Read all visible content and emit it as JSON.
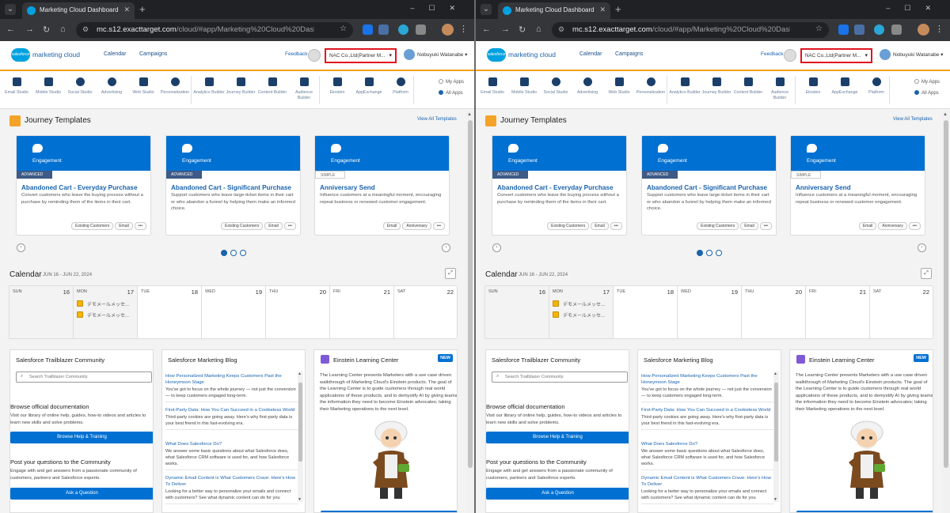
{
  "browser": {
    "tab_title": "Marketing Cloud Dashboard - M",
    "url_host": "mc.s12.exacttarget.com",
    "url_path": "/cloud/#app/Marketing%20Cloud%20Dashboa..."
  },
  "header": {
    "logo_badge": "salesforce",
    "logo_text": "marketing cloud",
    "nav": [
      "Calendar",
      "Campaigns"
    ],
    "feedback": "Feedback",
    "business_unit": "NAC Co.,Ltd(Partner M...",
    "user_name": "Nobuyuki Watanabe"
  },
  "apps": {
    "items": [
      {
        "label": "Email Studio"
      },
      {
        "label": "Mobile Studio"
      },
      {
        "label": "Social Studio"
      },
      {
        "label": "Advertising"
      },
      {
        "label": "Web Studio"
      },
      {
        "label": "Personalization"
      },
      {
        "label": "Analytics Builder"
      },
      {
        "label": "Journey Builder"
      },
      {
        "label": "Content Builder"
      },
      {
        "label": "Audience Builder"
      },
      {
        "label": "Einstein"
      },
      {
        "label": "AppExchange"
      },
      {
        "label": "Platform"
      }
    ],
    "my_apps": "My Apps",
    "all_apps": "All Apps"
  },
  "journey": {
    "title": "Journey Templates",
    "view_all": "View All Templates",
    "cards": [
      {
        "category": "Engagement",
        "level": "ADVANCED",
        "name": "Abandoned Cart - Everyday Purchase",
        "desc": "Convert customers who leave the buying process without a purchase by reminding them of the items in their cart.",
        "chips": [
          "Existing Customers",
          "Email",
          "•••"
        ]
      },
      {
        "category": "Engagement",
        "level": "ADVANCED",
        "name": "Abandoned Cart - Significant Purchase",
        "desc": "Support customers who leave large-ticket items in their cart or who abandon a funnel by helping them make an informed choice.",
        "chips": [
          "Existing Customers",
          "Email",
          "•••"
        ]
      },
      {
        "category": "Engagement",
        "level": "SIMPLE",
        "name": "Anniversary Send",
        "desc": "Influence customers at a meaningful moment, encouraging repeat business or renewed customer engagement.",
        "chips": [
          "Email",
          "Anniversary",
          "•••"
        ]
      }
    ]
  },
  "calendar": {
    "title": "Calendar",
    "range": "JUN 16 - JUN 22, 2024",
    "days": [
      {
        "name": "SUN",
        "num": "16"
      },
      {
        "name": "MON",
        "num": "17"
      },
      {
        "name": "TUE",
        "num": "18"
      },
      {
        "name": "WED",
        "num": "19"
      },
      {
        "name": "THU",
        "num": "20"
      },
      {
        "name": "FRI",
        "num": "21"
      },
      {
        "name": "SAT",
        "num": "22"
      }
    ],
    "events": [
      "デモメールメッセ...",
      "デモメールメッセ..."
    ]
  },
  "trailblazer": {
    "title": "Salesforce Trailblazer Community",
    "search_placeholder": "Search Trailblazer Community",
    "doc_heading": "Browse official documentation",
    "doc_text": "Visit our library of online help, guides, how-to videos and articles to learn new skills and solve problems.",
    "doc_button": "Browse Help & Training",
    "community_heading": "Post your questions to the Community",
    "community_text": "Engage with and get answers from a passionate community of customers, partners and Salesforce experts.",
    "community_button": "Ask a Question"
  },
  "blog": {
    "title": "Salesforce Marketing Blog",
    "items": [
      {
        "title": "How Personalized Marketing Keeps Customers Past the Honeymoon Stage",
        "desc": "You've got to focus on the whole journey — not just the conversion — to keep customers engaged long-term."
      },
      {
        "title": "First-Party Data: How You Can Succeed in a Cookieless World",
        "desc": "Third-party cookies are going away. Here's why first-party data is your best friend in this fast-evolving era."
      },
      {
        "title": "What Does Salesforce Do?",
        "desc": "We answer some basic questions about what Salesforce does, what Salesforce CRM software is used for, and how Salesforce works."
      },
      {
        "title": "Dynamic Email Content is What Customers Crave: Here's How To Deliver",
        "desc": "Looking for a better way to personalize your emails and connect with customers? See what dynamic content can do for you"
      }
    ]
  },
  "einstein": {
    "title": "Einstein Learning Center",
    "badge": "NEW",
    "text": "The Learning Center presents Marketers with a use case driven walkthrough of Marketing Cloud's Einstein products. The goal of the Learning Center is to guide customers through real world applications of these products, and to demystify AI by giving teams the information they need to become Einstein advocates; taking their Marketing operations to the next level."
  },
  "colors": {
    "accent": "#0070d2",
    "header_underline": "#f0a010",
    "highlight_box": "#e0161e"
  }
}
